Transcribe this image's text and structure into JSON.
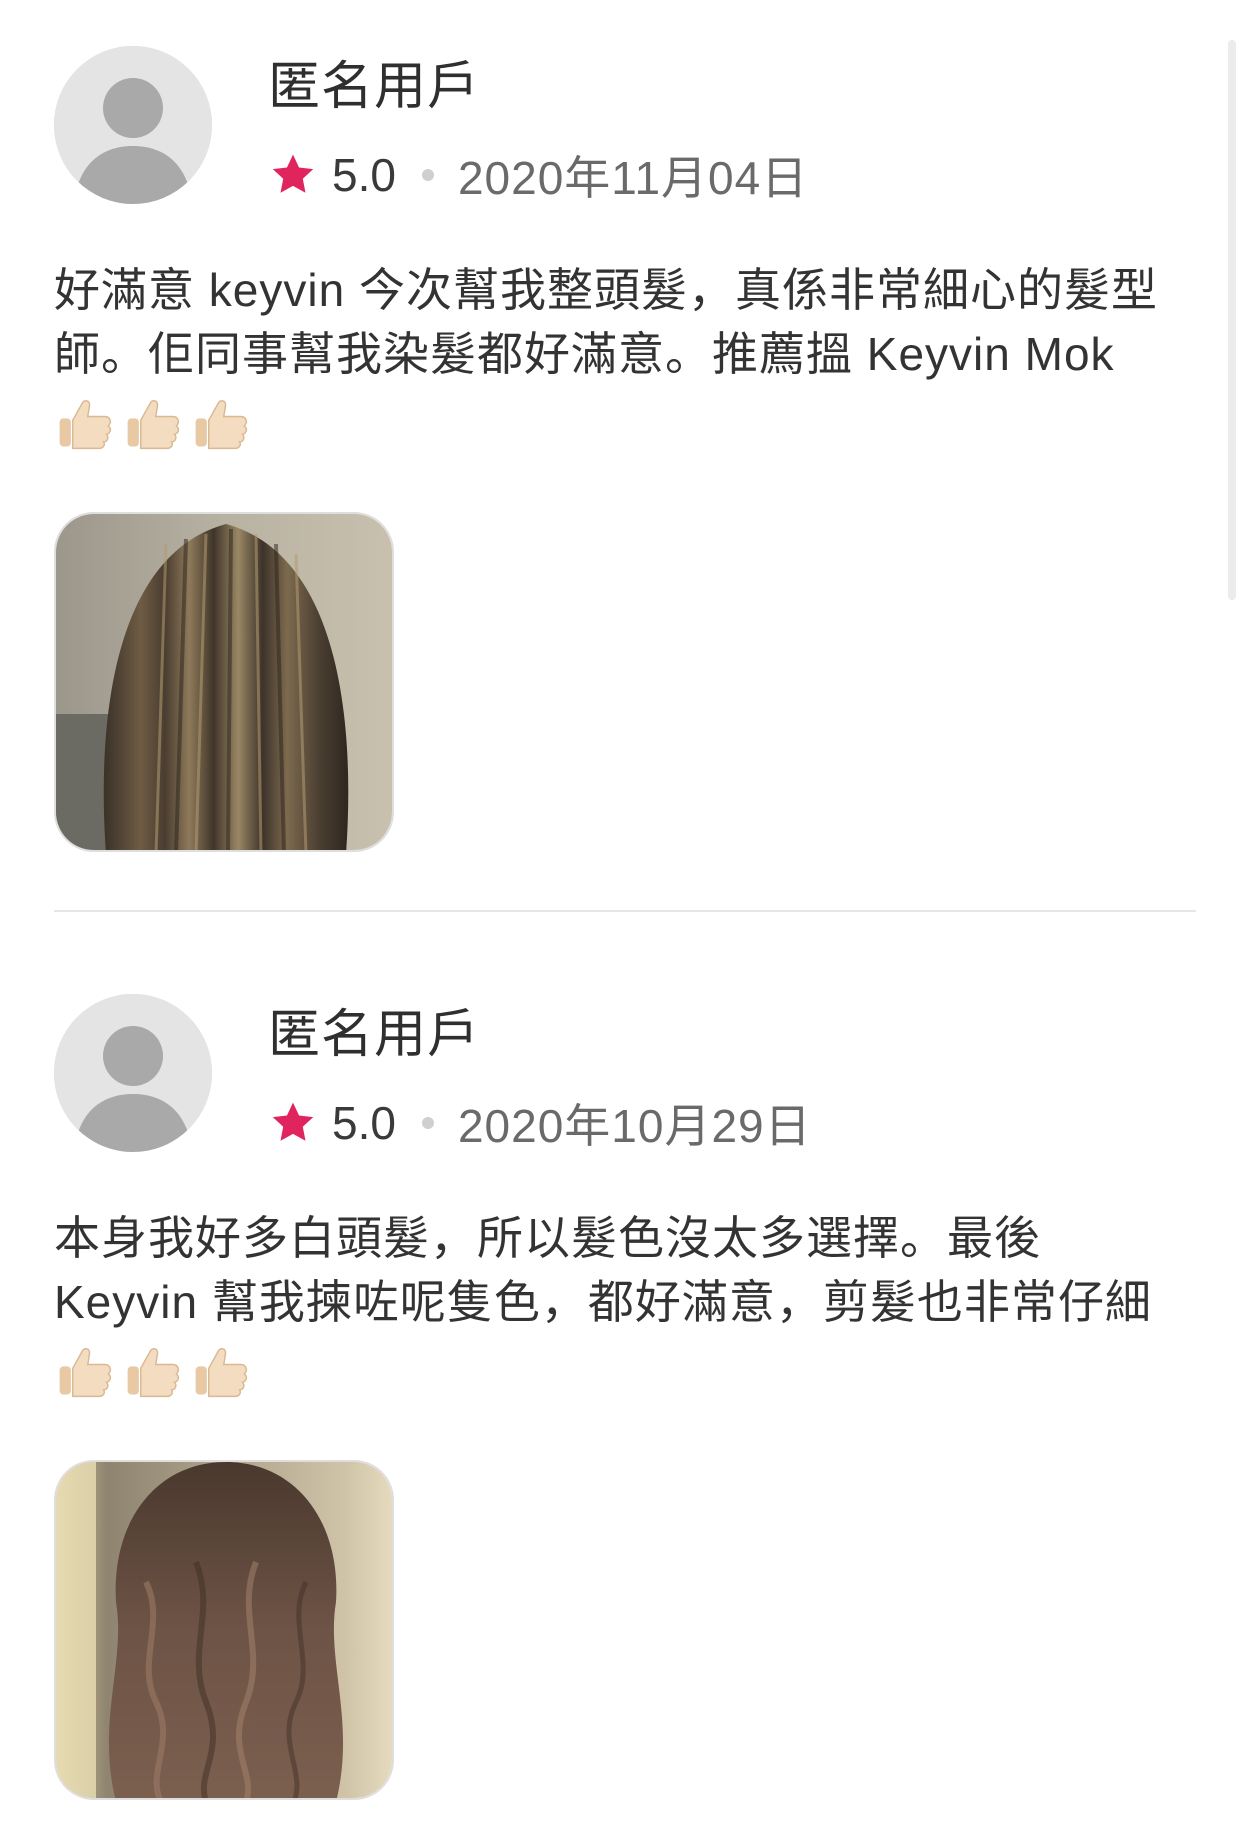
{
  "reviews": [
    {
      "user_name": "匿名用戶",
      "rating": "5.0",
      "date": "2020年11月04日",
      "text_lines": [
        "好滿意 keyvin 今次幫我整頭髮，真係非常細心的髮型",
        "師。佢同事幫我染髮都好滿意。推薦搵 Keyvin Mok"
      ],
      "emoji": [
        "thumbs-up",
        "thumbs-up",
        "thumbs-up"
      ],
      "photo": "straight-highlighted-hair"
    },
    {
      "user_name": "匿名用戶",
      "rating": "5.0",
      "date": "2020年10月29日",
      "text_lines": [
        "本身我好多白頭髮，所以髮色沒太多選擇。最後",
        "Keyvin 幫我揀咗呢隻色，都好滿意，剪髮也非常仔細"
      ],
      "emoji": [
        "thumbs-up",
        "thumbs-up",
        "thumbs-up"
      ],
      "photo": "wavy-brown-hair"
    }
  ],
  "colors": {
    "star": "#e0245e",
    "avatar_bg": "#e4e4e4",
    "avatar_fg": "#a9a9a9",
    "divider": "#e6e6e6"
  }
}
